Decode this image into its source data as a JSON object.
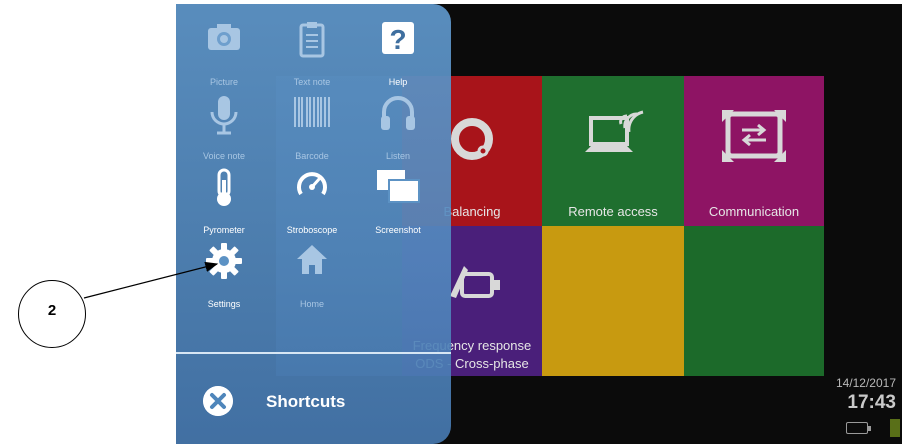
{
  "screen": {
    "tiles": {
      "balancing": "Balancing",
      "remote_access": "Remote access",
      "communication": "Communication",
      "freq_line1": "Frequency response",
      "freq_line2": "ODS - Cross-phase"
    },
    "date": "14/12/2017",
    "time": "17:43"
  },
  "panel": {
    "shortcuts": [
      {
        "label": "Picture",
        "icon": "camera-icon",
        "enabled": false
      },
      {
        "label": "Text note",
        "icon": "clipboard-icon",
        "enabled": false
      },
      {
        "label": "Help",
        "icon": "help-icon",
        "enabled": true
      },
      {
        "label": "Voice note",
        "icon": "microphone-icon",
        "enabled": false
      },
      {
        "label": "Barcode",
        "icon": "barcode-icon",
        "enabled": false
      },
      {
        "label": "Listen",
        "icon": "headphones-icon",
        "enabled": false
      },
      {
        "label": "Pyrometer",
        "icon": "thermometer-icon",
        "enabled": true
      },
      {
        "label": "Stroboscope",
        "icon": "gauge-icon",
        "enabled": true
      },
      {
        "label": "Screenshot",
        "icon": "screenshot-icon",
        "enabled": true
      },
      {
        "label": "Settings",
        "icon": "gear-icon",
        "enabled": true
      },
      {
        "label": "Home",
        "icon": "home-icon",
        "enabled": false
      }
    ],
    "footer_title": "Shortcuts"
  },
  "callout": {
    "number": "2"
  },
  "colors": {
    "panel": "#5c92c4",
    "balancing": "#a8141a",
    "remote": "#1f6f2f",
    "communication": "#8e1464",
    "frequency": "#4a1f7a",
    "yellow": "#c89a10"
  }
}
